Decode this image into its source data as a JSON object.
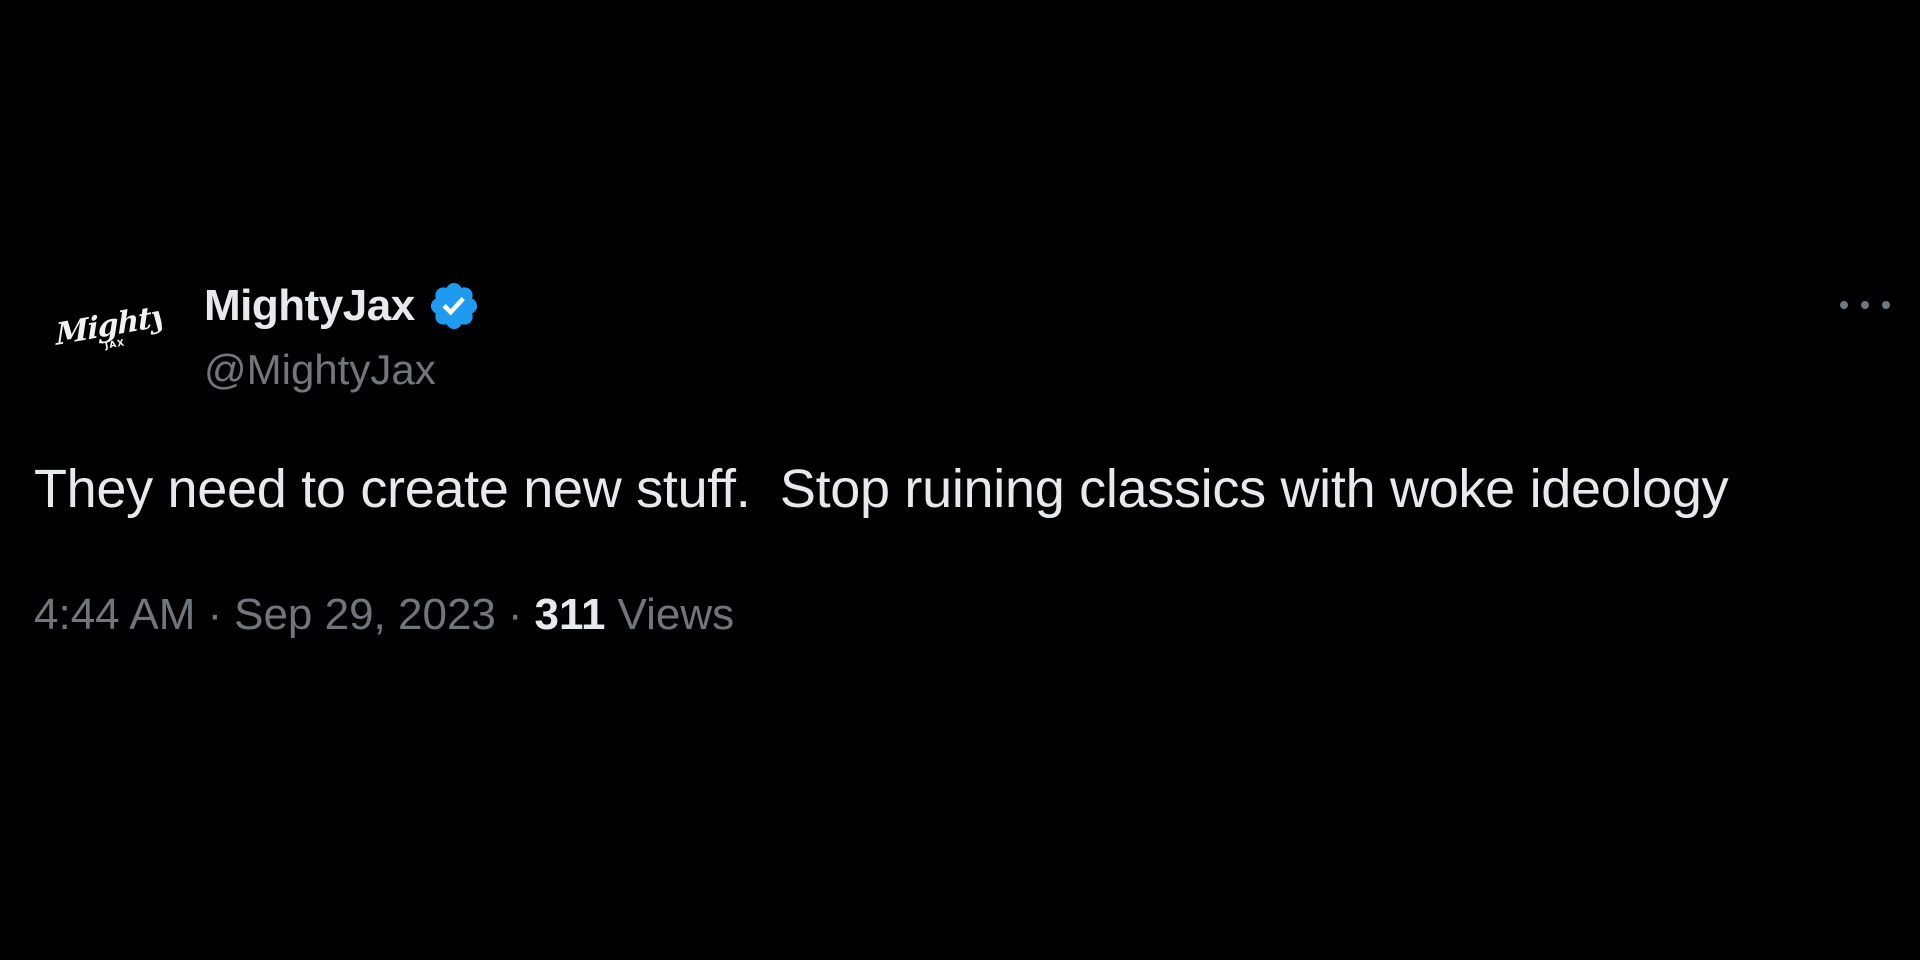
{
  "tweet": {
    "avatar": {
      "logo_text": "Mighty",
      "logo_subtext": "JAX"
    },
    "author": {
      "display_name": "MightyJax",
      "handle": "@MightyJax",
      "verified": true,
      "verified_color": "#1d9bf0"
    },
    "more_icon": "more-horizontal-icon",
    "text": "They need to create new stuff.  Stop ruining classics with woke ideology",
    "time": "4:44 AM",
    "separator": "·",
    "date": "Sep 29, 2023",
    "views_count": "311",
    "views_label": "Views"
  },
  "colors": {
    "background": "#000000",
    "primary_text": "#e7e9ea",
    "secondary_text": "#71767b",
    "verified": "#1d9bf0"
  }
}
